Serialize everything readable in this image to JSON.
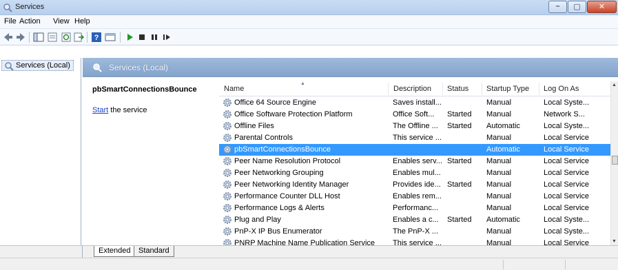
{
  "window": {
    "title": "Services",
    "buttons": [
      "minimize",
      "maximize",
      "close"
    ]
  },
  "menu": [
    "File",
    "Action",
    "View",
    "Help"
  ],
  "toolbar": [
    "back-icon",
    "forward-icon",
    "show-hide-tree-icon",
    "properties-icon",
    "refresh-icon",
    "export-list-icon",
    "help-icon",
    "console-icon",
    "play-icon",
    "stop-icon",
    "pause-icon",
    "restart-icon"
  ],
  "tree": {
    "item": "Services (Local)"
  },
  "panel": {
    "header": "Services (Local)"
  },
  "detail": {
    "service_name": "pbSmartConnectionsBounce",
    "start_link": "Start",
    "start_suffix": " the service"
  },
  "columns": [
    "Name",
    "Description",
    "Status",
    "Startup Type",
    "Log On As"
  ],
  "rows": [
    {
      "name": "Office 64 Source Engine",
      "description": "Saves install...",
      "status": "",
      "startup": "Manual",
      "logon": "Local Syste..."
    },
    {
      "name": "Office Software Protection Platform",
      "description": "Office Soft...",
      "status": "Started",
      "startup": "Manual",
      "logon": "Network S..."
    },
    {
      "name": "Offline Files",
      "description": "The Offline ...",
      "status": "Started",
      "startup": "Automatic",
      "logon": "Local Syste..."
    },
    {
      "name": "Parental Controls",
      "description": "This service ...",
      "status": "",
      "startup": "Manual",
      "logon": "Local Service"
    },
    {
      "name": "pbSmartConnectionsBounce",
      "description": "",
      "status": "",
      "startup": "Automatic",
      "logon": "Local Service",
      "selected": true
    },
    {
      "name": "Peer Name Resolution Protocol",
      "description": "Enables serv...",
      "status": "Started",
      "startup": "Manual",
      "logon": "Local Service"
    },
    {
      "name": "Peer Networking Grouping",
      "description": "Enables mul...",
      "status": "",
      "startup": "Manual",
      "logon": "Local Service"
    },
    {
      "name": "Peer Networking Identity Manager",
      "description": "Provides ide...",
      "status": "Started",
      "startup": "Manual",
      "logon": "Local Service"
    },
    {
      "name": "Performance Counter DLL Host",
      "description": "Enables rem...",
      "status": "",
      "startup": "Manual",
      "logon": "Local Service"
    },
    {
      "name": "Performance Logs & Alerts",
      "description": "Performanc...",
      "status": "",
      "startup": "Manual",
      "logon": "Local Service"
    },
    {
      "name": "Plug and Play",
      "description": "Enables a c...",
      "status": "Started",
      "startup": "Automatic",
      "logon": "Local Syste..."
    },
    {
      "name": "PnP-X IP Bus Enumerator",
      "description": "The PnP-X ...",
      "status": "",
      "startup": "Manual",
      "logon": "Local Syste..."
    },
    {
      "name": "PNRP Machine Name Publication Service",
      "description": "This service ...",
      "status": "",
      "startup": "Manual",
      "logon": "Local Service"
    }
  ],
  "tabs": [
    "Extended",
    "Standard"
  ],
  "colors": {
    "selection": "#3399ff",
    "link": "#1a47c8",
    "panel_header": "#8eaad2"
  }
}
